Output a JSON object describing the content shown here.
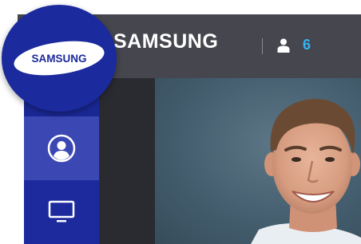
{
  "header": {
    "title": "SAMSUNG",
    "user_icon": "user-icon",
    "user_count": "6"
  },
  "logo": {
    "brand_text": "SAMSUNG",
    "brand_color": "#1b2a9c"
  },
  "sidebar": {
    "items": [
      {
        "icon": "profile-circle-icon",
        "state": "active"
      },
      {
        "icon": "monitor-icon",
        "state": "inactive"
      }
    ]
  },
  "colors": {
    "header_bg": "#46464f",
    "sidebar_bg": "#1b2a9c",
    "sidebar_active": "#3b48b4",
    "accent_count": "#32b4f0"
  }
}
